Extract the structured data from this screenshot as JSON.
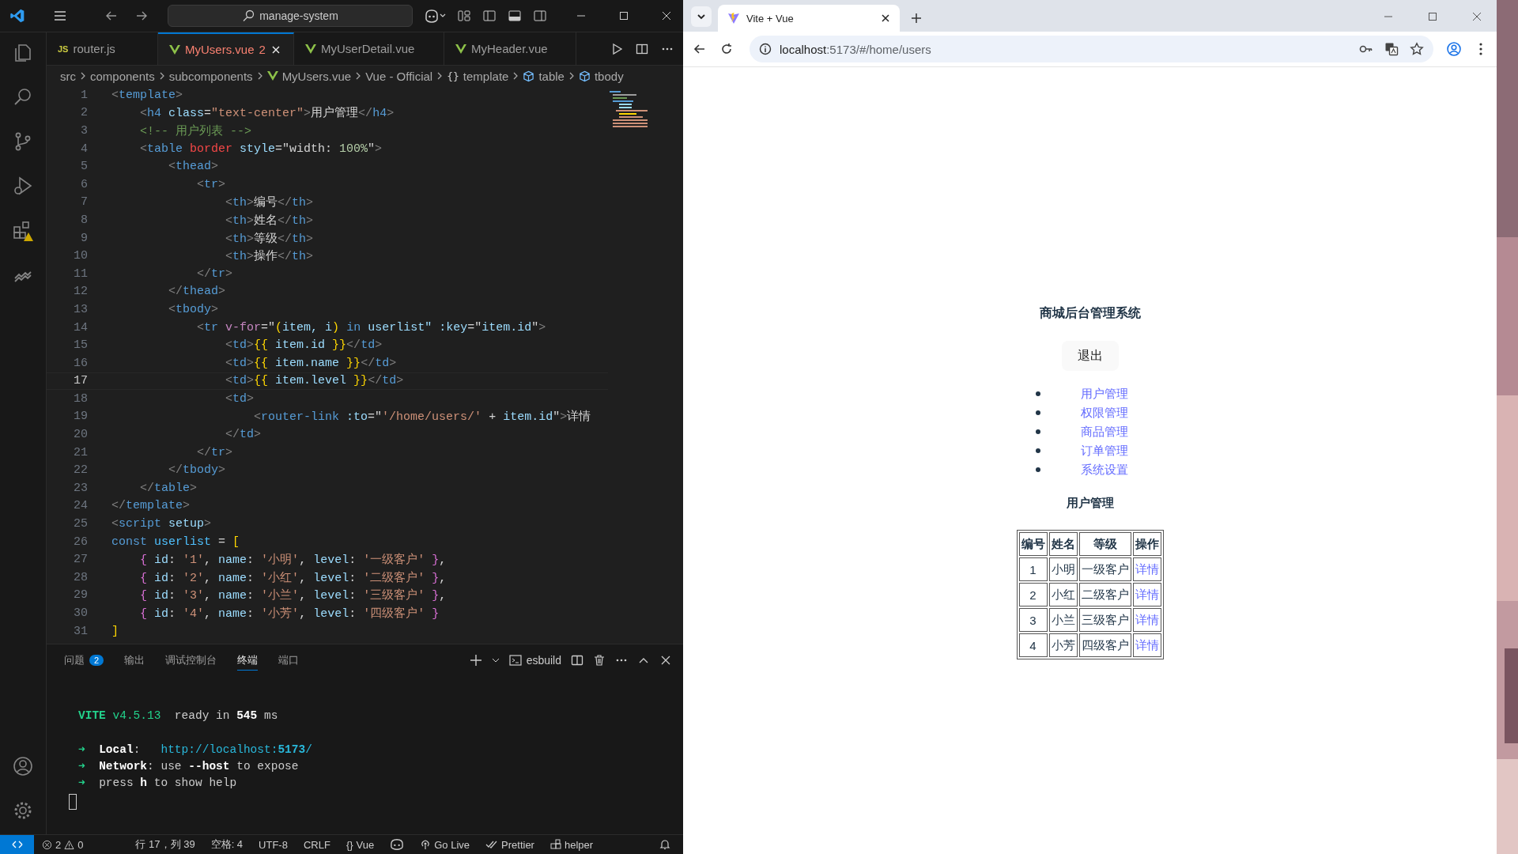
{
  "editor": {
    "search": "manage-system",
    "tabs": [
      {
        "label": "router.js",
        "kind": "js",
        "badge": "JS",
        "selected": false,
        "error": false
      },
      {
        "label": "MyUsers.vue",
        "kind": "vue",
        "selected": true,
        "error": true,
        "problems": "2"
      },
      {
        "label": "MyUserDetail.vue",
        "kind": "vue",
        "selected": false,
        "error": false
      },
      {
        "label": "MyHeader.vue",
        "kind": "vue",
        "selected": false,
        "error": false
      }
    ],
    "breadcrumbs": [
      {
        "label": "src",
        "kind": "folder"
      },
      {
        "label": "components",
        "kind": "folder"
      },
      {
        "label": "subcomponents",
        "kind": "folder"
      },
      {
        "label": "MyUsers.vue",
        "kind": "vue"
      },
      {
        "label": "Vue - Official",
        "kind": "folder"
      },
      {
        "label": "template",
        "kind": "object",
        "glyph": "{}"
      },
      {
        "label": "table",
        "kind": "element"
      },
      {
        "label": "tbody",
        "kind": "element"
      }
    ],
    "lines": [
      {
        "number": "1",
        "current": false,
        "tokens": [
          {
            "text": "<",
            "kind": "punct"
          },
          {
            "text": "template",
            "kind": "tag"
          },
          {
            "text": ">",
            "kind": "punct"
          }
        ]
      },
      {
        "number": "2",
        "current": false,
        "tokens": [
          {
            "text": "    <",
            "kind": "punct"
          },
          {
            "text": "h4",
            "kind": "tag"
          },
          {
            "text": " class",
            "kind": "attr"
          },
          {
            "text": "=",
            "kind": "text"
          },
          {
            "text": "\"text-center\"",
            "kind": "string"
          },
          {
            "text": ">",
            "kind": "punct"
          },
          {
            "text": "用户管理",
            "kind": "text"
          },
          {
            "text": "</",
            "kind": "punct"
          },
          {
            "text": "h4",
            "kind": "tag"
          },
          {
            "text": ">",
            "kind": "punct"
          }
        ]
      },
      {
        "number": "3",
        "current": false,
        "tokens": [
          {
            "text": "    <!-- 用户列表 -->",
            "kind": "comment"
          }
        ]
      },
      {
        "number": "4",
        "current": false,
        "tokens": [
          {
            "text": "    <",
            "kind": "punct"
          },
          {
            "text": "table",
            "kind": "tag"
          },
          {
            "text": " border",
            "kind": "warn"
          },
          {
            "text": " style",
            "kind": "attr"
          },
          {
            "text": "=\"width: ",
            "kind": "text"
          },
          {
            "text": "100%",
            "kind": "number"
          },
          {
            "text": "\"",
            "kind": "text"
          },
          {
            "text": ">",
            "kind": "punct"
          }
        ]
      },
      {
        "number": "5",
        "current": false,
        "tokens": [
          {
            "text": "        <",
            "kind": "punct"
          },
          {
            "text": "thead",
            "kind": "tag"
          },
          {
            "text": ">",
            "kind": "punct"
          }
        ]
      },
      {
        "number": "6",
        "current": false,
        "tokens": [
          {
            "text": "            <",
            "kind": "punct"
          },
          {
            "text": "tr",
            "kind": "tag"
          },
          {
            "text": ">",
            "kind": "punct"
          }
        ]
      },
      {
        "number": "7",
        "current": false,
        "tokens": [
          {
            "text": "                <",
            "kind": "punct"
          },
          {
            "text": "th",
            "kind": "tag"
          },
          {
            "text": ">",
            "kind": "punct"
          },
          {
            "text": "编号",
            "kind": "text"
          },
          {
            "text": "</",
            "kind": "punct"
          },
          {
            "text": "th",
            "kind": "tag"
          },
          {
            "text": ">",
            "kind": "punct"
          }
        ]
      },
      {
        "number": "8",
        "current": false,
        "tokens": [
          {
            "text": "                <",
            "kind": "punct"
          },
          {
            "text": "th",
            "kind": "tag"
          },
          {
            "text": ">",
            "kind": "punct"
          },
          {
            "text": "姓名",
            "kind": "text"
          },
          {
            "text": "</",
            "kind": "punct"
          },
          {
            "text": "th",
            "kind": "tag"
          },
          {
            "text": ">",
            "kind": "punct"
          }
        ]
      },
      {
        "number": "9",
        "current": false,
        "tokens": [
          {
            "text": "                <",
            "kind": "punct"
          },
          {
            "text": "th",
            "kind": "tag"
          },
          {
            "text": ">",
            "kind": "punct"
          },
          {
            "text": "等级",
            "kind": "text"
          },
          {
            "text": "</",
            "kind": "punct"
          },
          {
            "text": "th",
            "kind": "tag"
          },
          {
            "text": ">",
            "kind": "punct"
          }
        ]
      },
      {
        "number": "10",
        "current": false,
        "tokens": [
          {
            "text": "                <",
            "kind": "punct"
          },
          {
            "text": "th",
            "kind": "tag"
          },
          {
            "text": ">",
            "kind": "punct"
          },
          {
            "text": "操作",
            "kind": "text"
          },
          {
            "text": "</",
            "kind": "punct"
          },
          {
            "text": "th",
            "kind": "tag"
          },
          {
            "text": ">",
            "kind": "punct"
          }
        ]
      },
      {
        "number": "11",
        "current": false,
        "tokens": [
          {
            "text": "            </",
            "kind": "punct"
          },
          {
            "text": "tr",
            "kind": "tag"
          },
          {
            "text": ">",
            "kind": "punct"
          }
        ]
      },
      {
        "number": "12",
        "current": false,
        "tokens": [
          {
            "text": "        </",
            "kind": "punct"
          },
          {
            "text": "thead",
            "kind": "tag"
          },
          {
            "text": ">",
            "kind": "punct"
          }
        ]
      },
      {
        "number": "13",
        "current": false,
        "tokens": [
          {
            "text": "        <",
            "kind": "punct"
          },
          {
            "text": "tbody",
            "kind": "tag"
          },
          {
            "text": ">",
            "kind": "punct"
          }
        ]
      },
      {
        "number": "14",
        "current": false,
        "tokens": [
          {
            "text": "            <",
            "kind": "punct"
          },
          {
            "text": "tr",
            "kind": "tag"
          },
          {
            "text": " v-for",
            "kind": "directive"
          },
          {
            "text": "=\"",
            "kind": "text"
          },
          {
            "text": "(",
            "kind": "bracket"
          },
          {
            "text": "item, i",
            "kind": "attr"
          },
          {
            "text": ")",
            "kind": "bracket"
          },
          {
            "text": " in",
            "kind": "tag"
          },
          {
            "text": " userlist",
            "kind": "attr"
          },
          {
            "text": "\" :key",
            "kind": "attr"
          },
          {
            "text": "=\"",
            "kind": "text"
          },
          {
            "text": "item.id",
            "kind": "attr"
          },
          {
            "text": "\"",
            "kind": "text"
          },
          {
            "text": ">",
            "kind": "punct"
          }
        ]
      },
      {
        "number": "15",
        "current": false,
        "tokens": [
          {
            "text": "                <",
            "kind": "punct"
          },
          {
            "text": "td",
            "kind": "tag"
          },
          {
            "text": ">",
            "kind": "punct"
          },
          {
            "text": "{{",
            "kind": "bracket"
          },
          {
            "text": " item.id ",
            "kind": "attr"
          },
          {
            "text": "}}",
            "kind": "bracket"
          },
          {
            "text": "</",
            "kind": "punct"
          },
          {
            "text": "td",
            "kind": "tag"
          },
          {
            "text": ">",
            "kind": "punct"
          }
        ]
      },
      {
        "number": "16",
        "current": false,
        "tokens": [
          {
            "text": "                <",
            "kind": "punct"
          },
          {
            "text": "td",
            "kind": "tag"
          },
          {
            "text": ">",
            "kind": "punct"
          },
          {
            "text": "{{",
            "kind": "bracket"
          },
          {
            "text": " item.name ",
            "kind": "attr"
          },
          {
            "text": "}}",
            "kind": "bracket"
          },
          {
            "text": "</",
            "kind": "punct"
          },
          {
            "text": "td",
            "kind": "tag"
          },
          {
            "text": ">",
            "kind": "punct"
          }
        ]
      },
      {
        "number": "17",
        "current": true,
        "tokens": [
          {
            "text": "                <",
            "kind": "punct"
          },
          {
            "text": "td",
            "kind": "tag"
          },
          {
            "text": ">",
            "kind": "punct"
          },
          {
            "text": "{{",
            "kind": "bracket"
          },
          {
            "text": " item.level ",
            "kind": "attr"
          },
          {
            "text": "}}",
            "kind": "bracket"
          },
          {
            "text": "</",
            "kind": "punct"
          },
          {
            "text": "td",
            "kind": "tag"
          },
          {
            "text": ">",
            "kind": "punct"
          }
        ]
      },
      {
        "number": "18",
        "current": false,
        "tokens": [
          {
            "text": "                <",
            "kind": "punct"
          },
          {
            "text": "td",
            "kind": "tag"
          },
          {
            "text": ">",
            "kind": "punct"
          }
        ]
      },
      {
        "number": "19",
        "current": false,
        "tokens": [
          {
            "text": "                    <",
            "kind": "punct"
          },
          {
            "text": "router-link",
            "kind": "tag"
          },
          {
            "text": " :to",
            "kind": "attr"
          },
          {
            "text": "=\"",
            "kind": "text"
          },
          {
            "text": "'/home/users/'",
            "kind": "string"
          },
          {
            "text": " + ",
            "kind": "text"
          },
          {
            "text": "item.id",
            "kind": "attr"
          },
          {
            "text": "\"",
            "kind": "text"
          },
          {
            "text": ">",
            "kind": "punct"
          },
          {
            "text": "详情",
            "kind": "text"
          }
        ]
      },
      {
        "number": "20",
        "current": false,
        "tokens": [
          {
            "text": "                </",
            "kind": "punct"
          },
          {
            "text": "td",
            "kind": "tag"
          },
          {
            "text": ">",
            "kind": "punct"
          }
        ]
      },
      {
        "number": "21",
        "current": false,
        "tokens": [
          {
            "text": "            </",
            "kind": "punct"
          },
          {
            "text": "tr",
            "kind": "tag"
          },
          {
            "text": ">",
            "kind": "punct"
          }
        ]
      },
      {
        "number": "22",
        "current": false,
        "tokens": [
          {
            "text": "        </",
            "kind": "punct"
          },
          {
            "text": "tbody",
            "kind": "tag"
          },
          {
            "text": ">",
            "kind": "punct"
          }
        ]
      },
      {
        "number": "23",
        "current": false,
        "tokens": [
          {
            "text": "    </",
            "kind": "punct"
          },
          {
            "text": "table",
            "kind": "tag"
          },
          {
            "text": ">",
            "kind": "punct"
          }
        ]
      },
      {
        "number": "24",
        "current": false,
        "tokens": [
          {
            "text": "</",
            "kind": "punct"
          },
          {
            "text": "template",
            "kind": "tag"
          },
          {
            "text": ">",
            "kind": "punct"
          }
        ]
      },
      {
        "number": "25",
        "current": false,
        "tokens": [
          {
            "text": "<",
            "kind": "punct"
          },
          {
            "text": "script",
            "kind": "tag"
          },
          {
            "text": " setup",
            "kind": "attr"
          },
          {
            "text": ">",
            "kind": "punct"
          }
        ]
      },
      {
        "number": "26",
        "current": false,
        "tokens": [
          {
            "text": "const",
            "kind": "tag"
          },
          {
            "text": " userlist",
            "kind": "constant"
          },
          {
            "text": " = ",
            "kind": "text"
          },
          {
            "text": "[",
            "kind": "bracket"
          }
        ]
      },
      {
        "number": "27",
        "current": false,
        "tokens": [
          {
            "text": "    {",
            "kind": "brace"
          },
          {
            "text": " id",
            "kind": "attr"
          },
          {
            "text": ": ",
            "kind": "text"
          },
          {
            "text": "'1'",
            "kind": "string"
          },
          {
            "text": ", ",
            "kind": "text"
          },
          {
            "text": "name",
            "kind": "attr"
          },
          {
            "text": ": ",
            "kind": "text"
          },
          {
            "text": "'小明'",
            "kind": "string"
          },
          {
            "text": ", ",
            "kind": "text"
          },
          {
            "text": "level",
            "kind": "attr"
          },
          {
            "text": ": ",
            "kind": "text"
          },
          {
            "text": "'一级客户'",
            "kind": "string"
          },
          {
            "text": " }",
            "kind": "brace"
          },
          {
            "text": ",",
            "kind": "text"
          }
        ]
      },
      {
        "number": "28",
        "current": false,
        "tokens": [
          {
            "text": "    {",
            "kind": "brace"
          },
          {
            "text": " id",
            "kind": "attr"
          },
          {
            "text": ": ",
            "kind": "text"
          },
          {
            "text": "'2'",
            "kind": "string"
          },
          {
            "text": ", ",
            "kind": "text"
          },
          {
            "text": "name",
            "kind": "attr"
          },
          {
            "text": ": ",
            "kind": "text"
          },
          {
            "text": "'小红'",
            "kind": "string"
          },
          {
            "text": ", ",
            "kind": "text"
          },
          {
            "text": "level",
            "kind": "attr"
          },
          {
            "text": ": ",
            "kind": "text"
          },
          {
            "text": "'二级客户'",
            "kind": "string"
          },
          {
            "text": " }",
            "kind": "brace"
          },
          {
            "text": ",",
            "kind": "text"
          }
        ]
      },
      {
        "number": "29",
        "current": false,
        "tokens": [
          {
            "text": "    {",
            "kind": "brace"
          },
          {
            "text": " id",
            "kind": "attr"
          },
          {
            "text": ": ",
            "kind": "text"
          },
          {
            "text": "'3'",
            "kind": "string"
          },
          {
            "text": ", ",
            "kind": "text"
          },
          {
            "text": "name",
            "kind": "attr"
          },
          {
            "text": ": ",
            "kind": "text"
          },
          {
            "text": "'小兰'",
            "kind": "string"
          },
          {
            "text": ", ",
            "kind": "text"
          },
          {
            "text": "level",
            "kind": "attr"
          },
          {
            "text": ": ",
            "kind": "text"
          },
          {
            "text": "'三级客户'",
            "kind": "string"
          },
          {
            "text": " }",
            "kind": "brace"
          },
          {
            "text": ",",
            "kind": "text"
          }
        ]
      },
      {
        "number": "30",
        "current": false,
        "tokens": [
          {
            "text": "    {",
            "kind": "brace"
          },
          {
            "text": " id",
            "kind": "attr"
          },
          {
            "text": ": ",
            "kind": "text"
          },
          {
            "text": "'4'",
            "kind": "string"
          },
          {
            "text": ", ",
            "kind": "text"
          },
          {
            "text": "name",
            "kind": "attr"
          },
          {
            "text": ": ",
            "kind": "text"
          },
          {
            "text": "'小芳'",
            "kind": "string"
          },
          {
            "text": ", ",
            "kind": "text"
          },
          {
            "text": "level",
            "kind": "attr"
          },
          {
            "text": ": ",
            "kind": "text"
          },
          {
            "text": "'四级客户'",
            "kind": "string"
          },
          {
            "text": " }",
            "kind": "brace"
          }
        ]
      },
      {
        "number": "31",
        "current": false,
        "tokens": [
          {
            "text": "]",
            "kind": "bracket"
          }
        ]
      }
    ],
    "panel_tabs": [
      {
        "label": "问题",
        "badge": "2",
        "selected": false
      },
      {
        "label": "输出",
        "selected": false
      },
      {
        "label": "调试控制台",
        "selected": false
      },
      {
        "label": "终端",
        "selected": true
      },
      {
        "label": "端口",
        "selected": false
      }
    ],
    "terminal_name": "esbuild",
    "terminal": {
      "banner": [
        {
          "text": "VITE",
          "kind": "green-bold"
        },
        {
          "text": " v4.5.13",
          "kind": "green"
        },
        {
          "text": "  ready in ",
          "kind": "plain"
        },
        {
          "text": "545",
          "kind": "bold"
        },
        {
          "text": " ms",
          "kind": "plain"
        }
      ],
      "lines": [
        [
          {
            "text": "➜",
            "kind": "green"
          },
          {
            "text": "  Local",
            "kind": "bold"
          },
          {
            "text": ":   ",
            "kind": "plain"
          },
          {
            "text": "http://localhost:",
            "kind": "cyan"
          },
          {
            "text": "5173",
            "kind": "cyan-bold"
          },
          {
            "text": "/",
            "kind": "cyan"
          }
        ],
        [
          {
            "text": "➜",
            "kind": "green"
          },
          {
            "text": "  Network",
            "kind": "bold"
          },
          {
            "text": ": use ",
            "kind": "plain"
          },
          {
            "text": "--host",
            "kind": "bold"
          },
          {
            "text": " to expose",
            "kind": "plain"
          }
        ],
        [
          {
            "text": "➜",
            "kind": "green"
          },
          {
            "text": "  press ",
            "kind": "plain"
          },
          {
            "text": "h",
            "kind": "bold"
          },
          {
            "text": " to show help",
            "kind": "plain"
          }
        ]
      ]
    },
    "status": {
      "errors": "2",
      "warnings": "0",
      "items": [
        {
          "kind": "text",
          "label": "行 17，列 39"
        },
        {
          "kind": "text",
          "label": "空格: 4"
        },
        {
          "kind": "text",
          "label": "UTF-8"
        },
        {
          "kind": "text",
          "label": "CRLF"
        },
        {
          "kind": "language",
          "glyph": "{}",
          "label": "Vue"
        },
        {
          "kind": "copilot"
        },
        {
          "kind": "broadcast",
          "label": "Go Live"
        },
        {
          "kind": "checks",
          "label": "Prettier"
        },
        {
          "kind": "blocks",
          "label": "helper"
        }
      ]
    }
  },
  "browser": {
    "tab_title": "Vite + Vue",
    "url_host": "localhost",
    "url_path": ":5173/#/home/users",
    "page": {
      "title": "商城后台管理系统",
      "logout": "退出",
      "nav": [
        "用户管理",
        "权限管理",
        "商品管理",
        "订单管理",
        "系统设置"
      ],
      "heading": "用户管理",
      "table": {
        "columns": [
          "编号",
          "姓名",
          "等级",
          "操作"
        ],
        "rows": [
          [
            "1",
            "小明",
            "一级客户",
            "详情"
          ],
          [
            "2",
            "小红",
            "二级客户",
            "详情"
          ],
          [
            "3",
            "小兰",
            "三级客户",
            "详情"
          ],
          [
            "4",
            "小芳",
            "四级客户",
            "详情"
          ]
        ]
      }
    }
  }
}
